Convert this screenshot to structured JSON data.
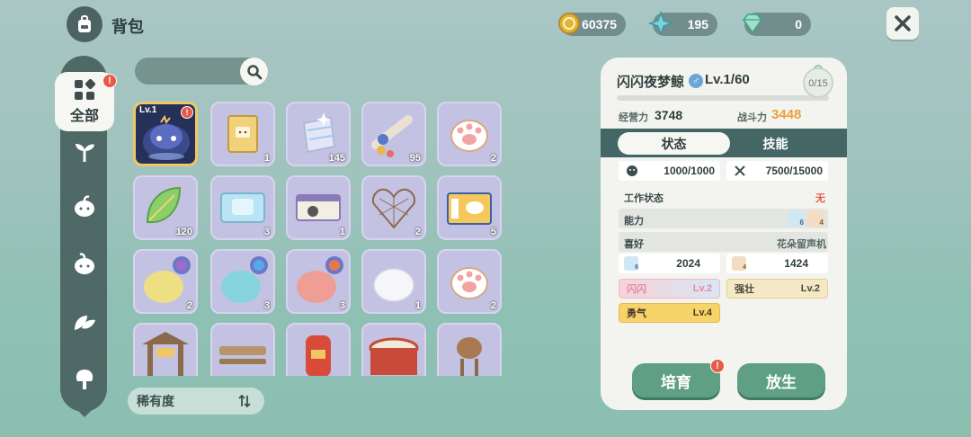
{
  "header": {
    "title": "背包",
    "coins": "60375",
    "stars": "195",
    "gems": "0"
  },
  "nav": {
    "active_label": "全部",
    "items": [
      "sprout-icon",
      "leaf-face-icon",
      "leaf-face-icon",
      "leaves-icon",
      "tree-icon"
    ]
  },
  "inventory": {
    "items": [
      {
        "name": "selected-pet",
        "count": "",
        "lv": "Lv.1",
        "alert": true
      },
      {
        "name": "box-item",
        "count": "1"
      },
      {
        "name": "shiny-fabric-item",
        "count": "145"
      },
      {
        "name": "fish-stick-item",
        "count": "95"
      },
      {
        "name": "paw-cookie-item",
        "count": "2"
      },
      {
        "name": "leaf-item",
        "count": "120"
      },
      {
        "name": "ice-ticket-item",
        "count": "3"
      },
      {
        "name": "photo-ticket-item",
        "count": "1"
      },
      {
        "name": "heart-net-item",
        "count": "2"
      },
      {
        "name": "coupon-item",
        "count": "5"
      },
      {
        "name": "yellow-slime-item",
        "count": "2"
      },
      {
        "name": "cyan-slime-item",
        "count": "3"
      },
      {
        "name": "pink-slime-item",
        "count": "3"
      },
      {
        "name": "white-slime-item",
        "count": "1"
      },
      {
        "name": "paw-cookie-item-2",
        "count": "2"
      },
      {
        "name": "shrine-item",
        "count": ""
      },
      {
        "name": "bench-item",
        "count": ""
      },
      {
        "name": "lantern-item",
        "count": ""
      },
      {
        "name": "drum-item",
        "count": ""
      },
      {
        "name": "tower-item",
        "count": ""
      }
    ]
  },
  "sort": {
    "label": "稀有度"
  },
  "pet": {
    "name": "闪闪夜梦鲸",
    "gender": "♂",
    "level": "Lv.1/60",
    "badge": "0/15",
    "xp_fraction": 0.0,
    "manage_label": "经营力",
    "manage_value": "3748",
    "combat_label": "战斗力",
    "combat_value": "3448",
    "tab_status": "状态",
    "tab_skills": "技能",
    "mood": "1000/1000",
    "food": "7500/15000",
    "work_label": "工作状态",
    "work_value": "无",
    "ability_label": "能力",
    "ability_water": "6",
    "ability_hand": "4",
    "like_label": "喜好",
    "like_value": "花朵留声机",
    "water_level": "6",
    "water_value": "2024",
    "hand_level": "4",
    "hand_value": "1424",
    "traits": [
      {
        "name": "闪闪",
        "lv": "Lv.2"
      },
      {
        "name": "强壮",
        "lv": "Lv.2"
      },
      {
        "name": "勇气",
        "lv": "Lv.4"
      }
    ],
    "btn_train": "培育",
    "btn_release": "放生"
  },
  "colors": {
    "accent_green": "#5fa085",
    "dark_teal": "#446664",
    "combat_orange": "#e8a23a",
    "alert_red": "#e85a46"
  }
}
